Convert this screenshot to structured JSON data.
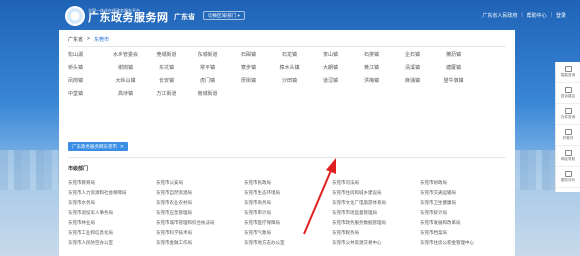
{
  "header": {
    "logo_sub": "全国一体化在线政务服务平台",
    "logo_main": "广东政务服务网",
    "province": "广东省",
    "switch_region": "切换区域/部门 ▾",
    "links": [
      "广东省人民政府",
      "|",
      "帮助中心",
      "|",
      "登录"
    ]
  },
  "breadcrumb": [
    "广东省",
    ">",
    "东莞市"
  ],
  "towns": [
    [
      "松山湖",
      "水乡管委会",
      "莞城街道",
      "东城街道",
      "石碣镇",
      "石龙镇",
      "茶山镇",
      "石排镇",
      "企石镇",
      "横沥镇"
    ],
    [
      "桥头镇",
      "谢岗镇",
      "东坑镇",
      "常平镇",
      "寮步镇",
      "樟木头镇",
      "大朗镇",
      "黄江镇",
      "清溪镇",
      "塘厦镇"
    ],
    [
      "凤岗镇",
      "大岭山镇",
      "长安镇",
      "虎门镇",
      "厚街镇",
      "沙田镇",
      "道滘镇",
      "洪梅镇",
      "麻涌镇",
      "望牛墩镇"
    ],
    [
      "中堂镇",
      "高埗镇",
      "万江街道",
      "南城街道",
      "",
      "",
      "",
      "",
      "",
      ""
    ]
  ],
  "tag": {
    "label": "广东政务服务网东莞市",
    "close": "✕"
  },
  "section_title": "市级部门",
  "departments": [
    [
      "东莞市教育局",
      "东莞市公安局",
      "东莞市民政局",
      "东莞市司法局",
      "东莞市财政局"
    ],
    [
      "东莞市人力资源和社会保障局",
      "东莞市自然资源局",
      "东莞市生态环境局",
      "东莞市住房和城乡建设局",
      "东莞市交通运输局"
    ],
    [
      "东莞市水务局",
      "东莞市农业农村局",
      "东莞市商务局",
      "东莞市文化广电旅游体育局",
      "东莞市卫生健康局"
    ],
    [
      "东莞市退役军人事务局",
      "东莞市应急管理局",
      "东莞市审计局",
      "东莞市市场监督管理局",
      "东莞市统计局"
    ],
    [
      "东莞市林业局",
      "东莞市城市管理和综合执法局",
      "东莞市医疗保障局",
      "东莞市政务服务数据管理局",
      "东莞市发展和改革局"
    ],
    [
      "东莞市工业和信息化局",
      "东莞市科学技术局",
      "东莞市气象局",
      "东莞市税务局",
      "东莞市档案局"
    ],
    [
      "东莞市人民防空办公室",
      "东莞市金融工作局",
      "东莞市地方志办公室",
      "东莞市公共资源交易中心",
      "东莞市住房公积金管理中心"
    ]
  ],
  "sidebar": [
    "智能咨询",
    "投诉建议",
    "办件查询",
    "好差评",
    "网站导航",
    "服务评价"
  ],
  "colors": {
    "accent": "#3a8ee6",
    "header_bg": "#1f63b6",
    "arrow": "#e02020"
  }
}
